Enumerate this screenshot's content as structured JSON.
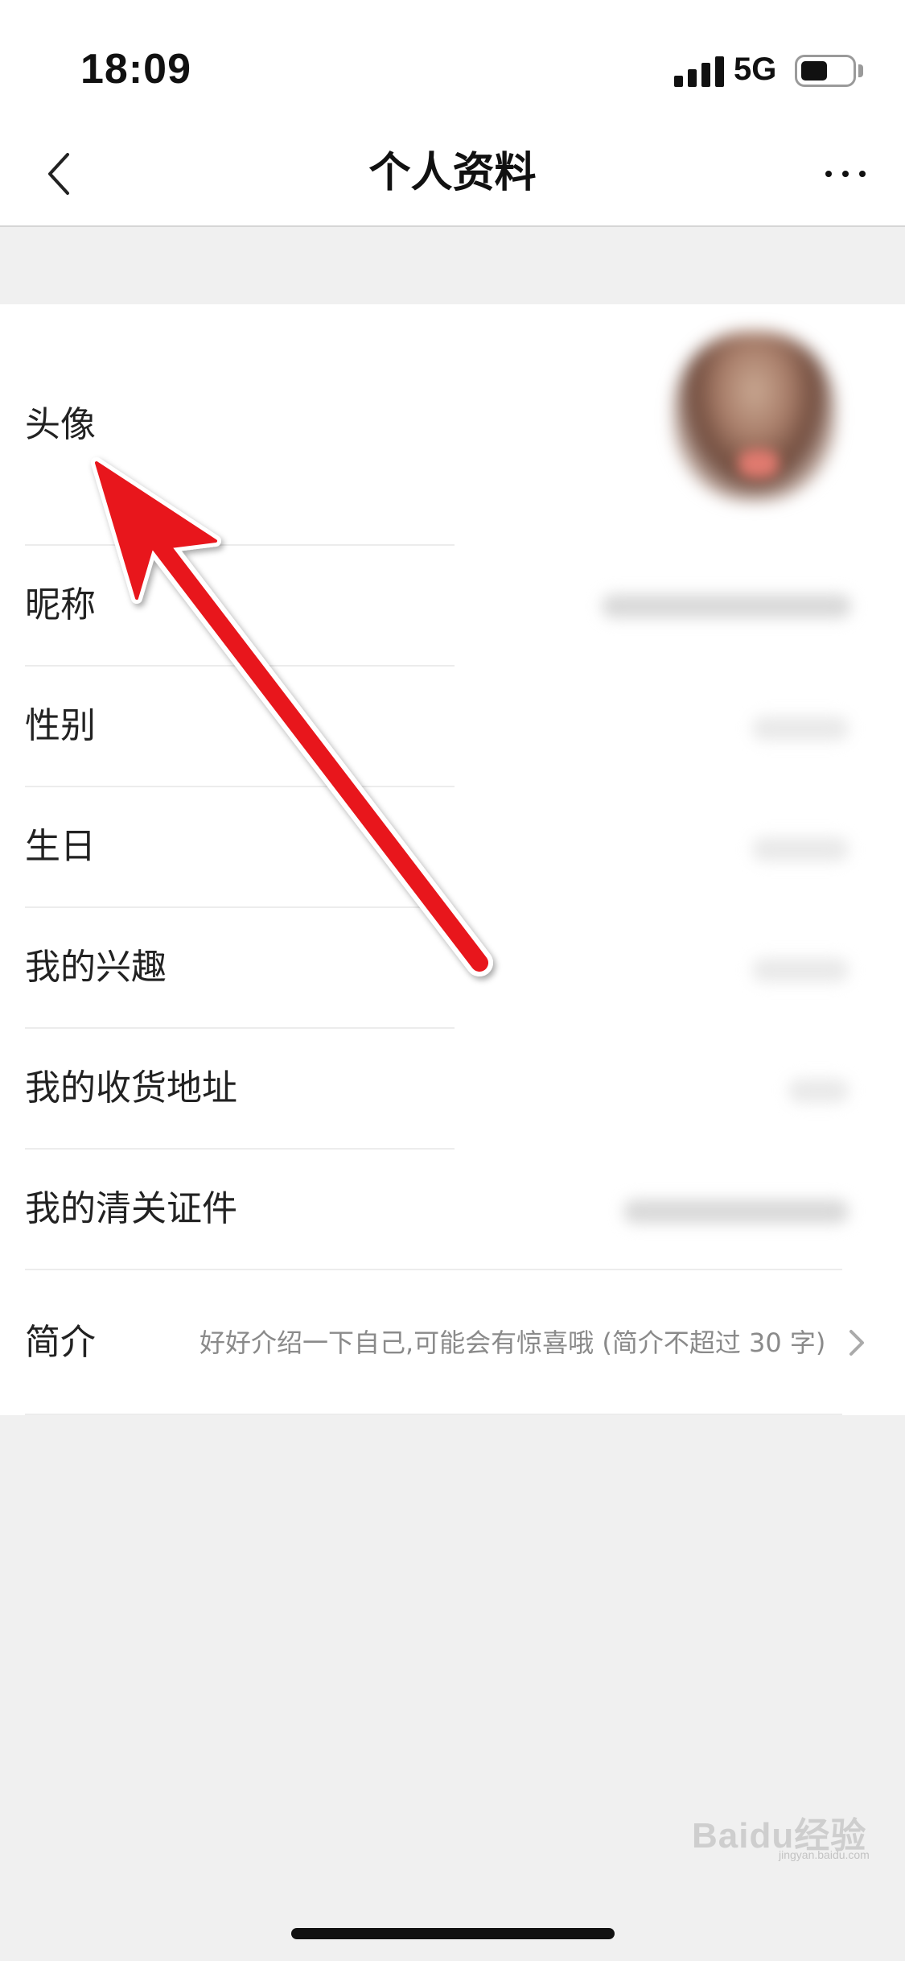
{
  "status_bar": {
    "time": "18:09",
    "network": "5G",
    "battery_level": 0.5
  },
  "nav": {
    "title": "个人资料",
    "back_icon": "chevron-left-icon",
    "more_icon": "ellipsis-icon"
  },
  "profile": {
    "rows": [
      {
        "label": "头像"
      },
      {
        "label": "昵称"
      },
      {
        "label": "性别"
      },
      {
        "label": "生日"
      },
      {
        "label": "我的兴趣"
      },
      {
        "label": "我的收货地址"
      },
      {
        "label": "我的清关证件"
      },
      {
        "label": "简介",
        "value": "好好介绍一下自己,可能会有惊喜哦 (简介不超过 30 字)"
      }
    ]
  },
  "annotation": {
    "color": "#e8141c",
    "icon": "arrow-pointer-icon"
  },
  "watermark": {
    "text": "Baidu经验",
    "url": "jingyan.baidu.com"
  }
}
